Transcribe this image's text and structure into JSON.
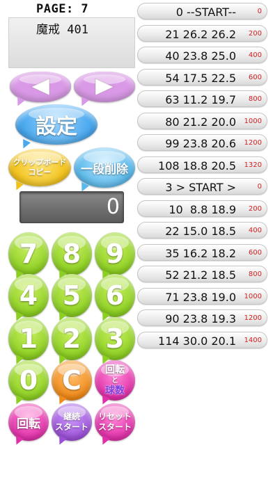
{
  "header": {
    "page_label": "PAGE: 7",
    "info_text": "魔戒 401"
  },
  "buttons": {
    "settings": "設定",
    "clipboard_copy": "クリップボード\nコピー",
    "delete_row": "一段削除",
    "reset_spin": "回転",
    "spin_balls_top": "回転",
    "spin_balls_mid": "と",
    "spin_balls_bottom": "球数",
    "continue_start": "継続\nスタート",
    "reset_start": "リセット\nスタート",
    "clear": "C"
  },
  "display": {
    "value": "0"
  },
  "keypad": [
    "7",
    "8",
    "9",
    "4",
    "5",
    "6",
    "1",
    "2",
    "3",
    "0"
  ],
  "rows": [
    {
      "main": "0 --START--",
      "sub": "0"
    },
    {
      "main": "21 26.2 26.2",
      "sub": "200"
    },
    {
      "main": "40 23.8 25.0",
      "sub": "400"
    },
    {
      "main": "54 17.5 22.5",
      "sub": "600"
    },
    {
      "main": "63 11.2 19.7",
      "sub": "800"
    },
    {
      "main": "80 21.2 20.0",
      "sub": "1000"
    },
    {
      "main": "99 23.8 20.6",
      "sub": "1200"
    },
    {
      "main": "108 18.8 20.5",
      "sub": "1320"
    },
    {
      "main": "3 > START >",
      "sub": "0"
    },
    {
      "main": "10  8.8 18.9",
      "sub": "200"
    },
    {
      "main": "22 15.0 18.5",
      "sub": "400"
    },
    {
      "main": "35 16.2 18.2",
      "sub": "600"
    },
    {
      "main": "52 21.2 18.5",
      "sub": "800"
    },
    {
      "main": "71 23.8 19.0",
      "sub": "1000"
    },
    {
      "main": "90 23.8 19.3",
      "sub": "1200"
    },
    {
      "main": "114 30.0 20.1",
      "sub": "1400"
    }
  ],
  "colors": {
    "digit_green": "#8ccf22",
    "arrow_purple": "#d999e6",
    "settings_blue": "#4aa8ee",
    "clipboard_yellow": "#f2c21a",
    "delete_blue": "#5ab8ea",
    "clear_orange": "#f08a18",
    "magenta": "#e12fa8",
    "violet": "#9b4fd6",
    "sub_text_red": "#d02020"
  }
}
